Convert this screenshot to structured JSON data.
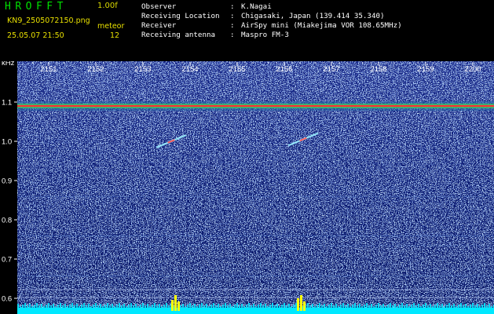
{
  "header": {
    "app_title": "HROFFT",
    "version": "1.00f",
    "filename": "KN9_2505072150.png",
    "mode": "meteor",
    "datetime": "25.05.07 21:50",
    "count": "12",
    "info": [
      {
        "label": "Observer",
        "value": "K.Nagai"
      },
      {
        "label": "Receiving Location",
        "value": "Chigasaki, Japan (139.414 35.340)"
      },
      {
        "label": "Receiver",
        "value": "AirSpy mini (Miakejima VOR 108.65MHz)"
      },
      {
        "label": "Receiving antenna",
        "value": "Maspro FM-3"
      }
    ]
  },
  "spectrogram": {
    "y_unit": "kHz",
    "y_ticks": [
      "1.1",
      "1.0",
      "0.9",
      "0.8",
      "0.7",
      "0.6"
    ],
    "x_ticks": [
      "2151",
      "2152",
      "2153",
      "2154",
      "2155",
      "2156",
      "2157",
      "2158",
      "2159",
      "2200"
    ],
    "carrier_khz": 1.09,
    "meteor_echoes": [
      {
        "start_time": "2153.3",
        "end_time": "2153.9",
        "start_khz": 0.985,
        "end_khz": 1.015
      },
      {
        "start_time": "2156.1",
        "end_time": "2156.7",
        "start_khz": 0.99,
        "end_khz": 1.02
      }
    ],
    "colors": {
      "background": "#0a1a78",
      "carrier": "#ff3030",
      "baseline": "#00e8ff",
      "spikes": "#ffff00"
    }
  }
}
